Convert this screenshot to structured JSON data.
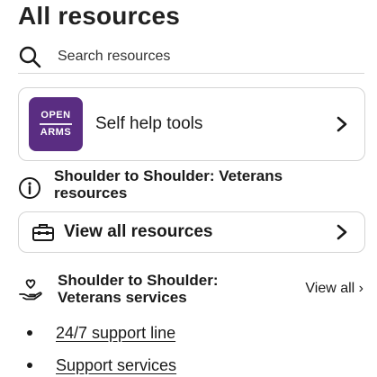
{
  "page": {
    "title": "All resources"
  },
  "search": {
    "placeholder": "Search resources",
    "icon": "search-icon"
  },
  "self_help_card": {
    "logo": {
      "line1": "OPEN",
      "line2": "ARMS",
      "bg_color": "#5a2d82"
    },
    "label": "Self help tools",
    "icon": "chevron-right-icon"
  },
  "resources_section": {
    "icon": "info-icon",
    "title_line1": "Shoulder to Shoulder: Veterans",
    "title_line2": "resources"
  },
  "view_all_resources_card": {
    "icon": "toolbox-icon",
    "label": "View all resources",
    "chevron": "chevron-right-icon"
  },
  "services_section": {
    "icon": "heart-hand-icon",
    "title_line1": "Shoulder to Shoulder:",
    "title_line2": "Veterans services",
    "view_all_label": "View all ›"
  },
  "service_links": [
    {
      "label": "24/7 support line"
    },
    {
      "label": "Support services"
    }
  ]
}
